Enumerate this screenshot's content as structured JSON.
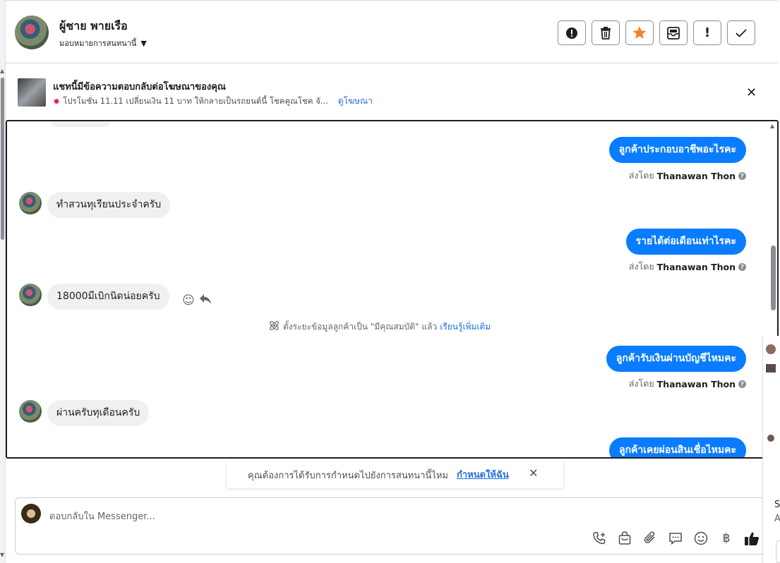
{
  "header": {
    "contact_name": "ผู้ชาย พายเรือ",
    "assign_label": "มอบหมายการสนทนานี้",
    "toolbar": [
      {
        "icon": "alert-circle-icon",
        "name": "report-button"
      },
      {
        "icon": "trash-icon",
        "name": "delete-button"
      },
      {
        "icon": "star-icon",
        "name": "star-button"
      },
      {
        "icon": "mark-unread-icon",
        "name": "mark-unread-button"
      },
      {
        "icon": "exclamation-icon",
        "name": "spam-button"
      },
      {
        "icon": "check-icon",
        "name": "mark-done-button"
      }
    ]
  },
  "ad_banner": {
    "title": "แชทนี้มีข้อความตอบกลับต่อโฆษณาของคุณ",
    "subtitle": "โปรโมชั่น 11.11 เปลี่ยนเงิน 11 บาท ให้กลายเป็นรถยนต์นี้ โชคคูณโชค จั...",
    "link": "ดูโฆษณา"
  },
  "messages": [
    {
      "dir": "out",
      "text": "ลูกค้าประกอบอาชีพอะไรคะ",
      "sent_by_prefix": "ส่งโดย",
      "sent_by": "Thanawan Thon"
    },
    {
      "dir": "in",
      "text": "ทำสวนทุเรียนประจำครับ"
    },
    {
      "dir": "out",
      "text": "รายได้ต่อเดือนเท่าไรคะ",
      "sent_by_prefix": "ส่งโดย",
      "sent_by": "Thanawan Thon"
    },
    {
      "dir": "in",
      "text": "18000มีเบิกนิดน่อยครับ"
    },
    {
      "dir": "out",
      "text": "ลูกค้ารับเงินผ่านบัญชีไหมคะ",
      "sent_by_prefix": "ส่งโดย",
      "sent_by": "Thanawan Thon"
    },
    {
      "dir": "in",
      "text": "ผ่านครับทุเดือนครับ"
    },
    {
      "dir": "out",
      "text": "ลูกค้าเคยผ่อนสินเชื่อไหมคะ"
    }
  ],
  "system_note": {
    "text": "ตั้งระยะข้อมูลลูกค้าเป็น \"มีคุณสมบัติ\" แล้ว",
    "link": "เรียนรู้เพิ่มเติม"
  },
  "suggestion": {
    "text": "คุณต้องการได้รับการกำหนดไปยังการสนทนานี้ไหม",
    "link": "กำหนดให้ฉัน"
  },
  "composer": {
    "placeholder": "ตอบกลับใน Messenger...",
    "icons": [
      "phone-plus-icon",
      "shopping-bag-icon",
      "paperclip-icon",
      "chat-bubbles-icon",
      "emoji-icon",
      "baht-icon",
      "thumbs-up-icon"
    ]
  },
  "right_panel": {
    "s": "S",
    "a": "A"
  }
}
